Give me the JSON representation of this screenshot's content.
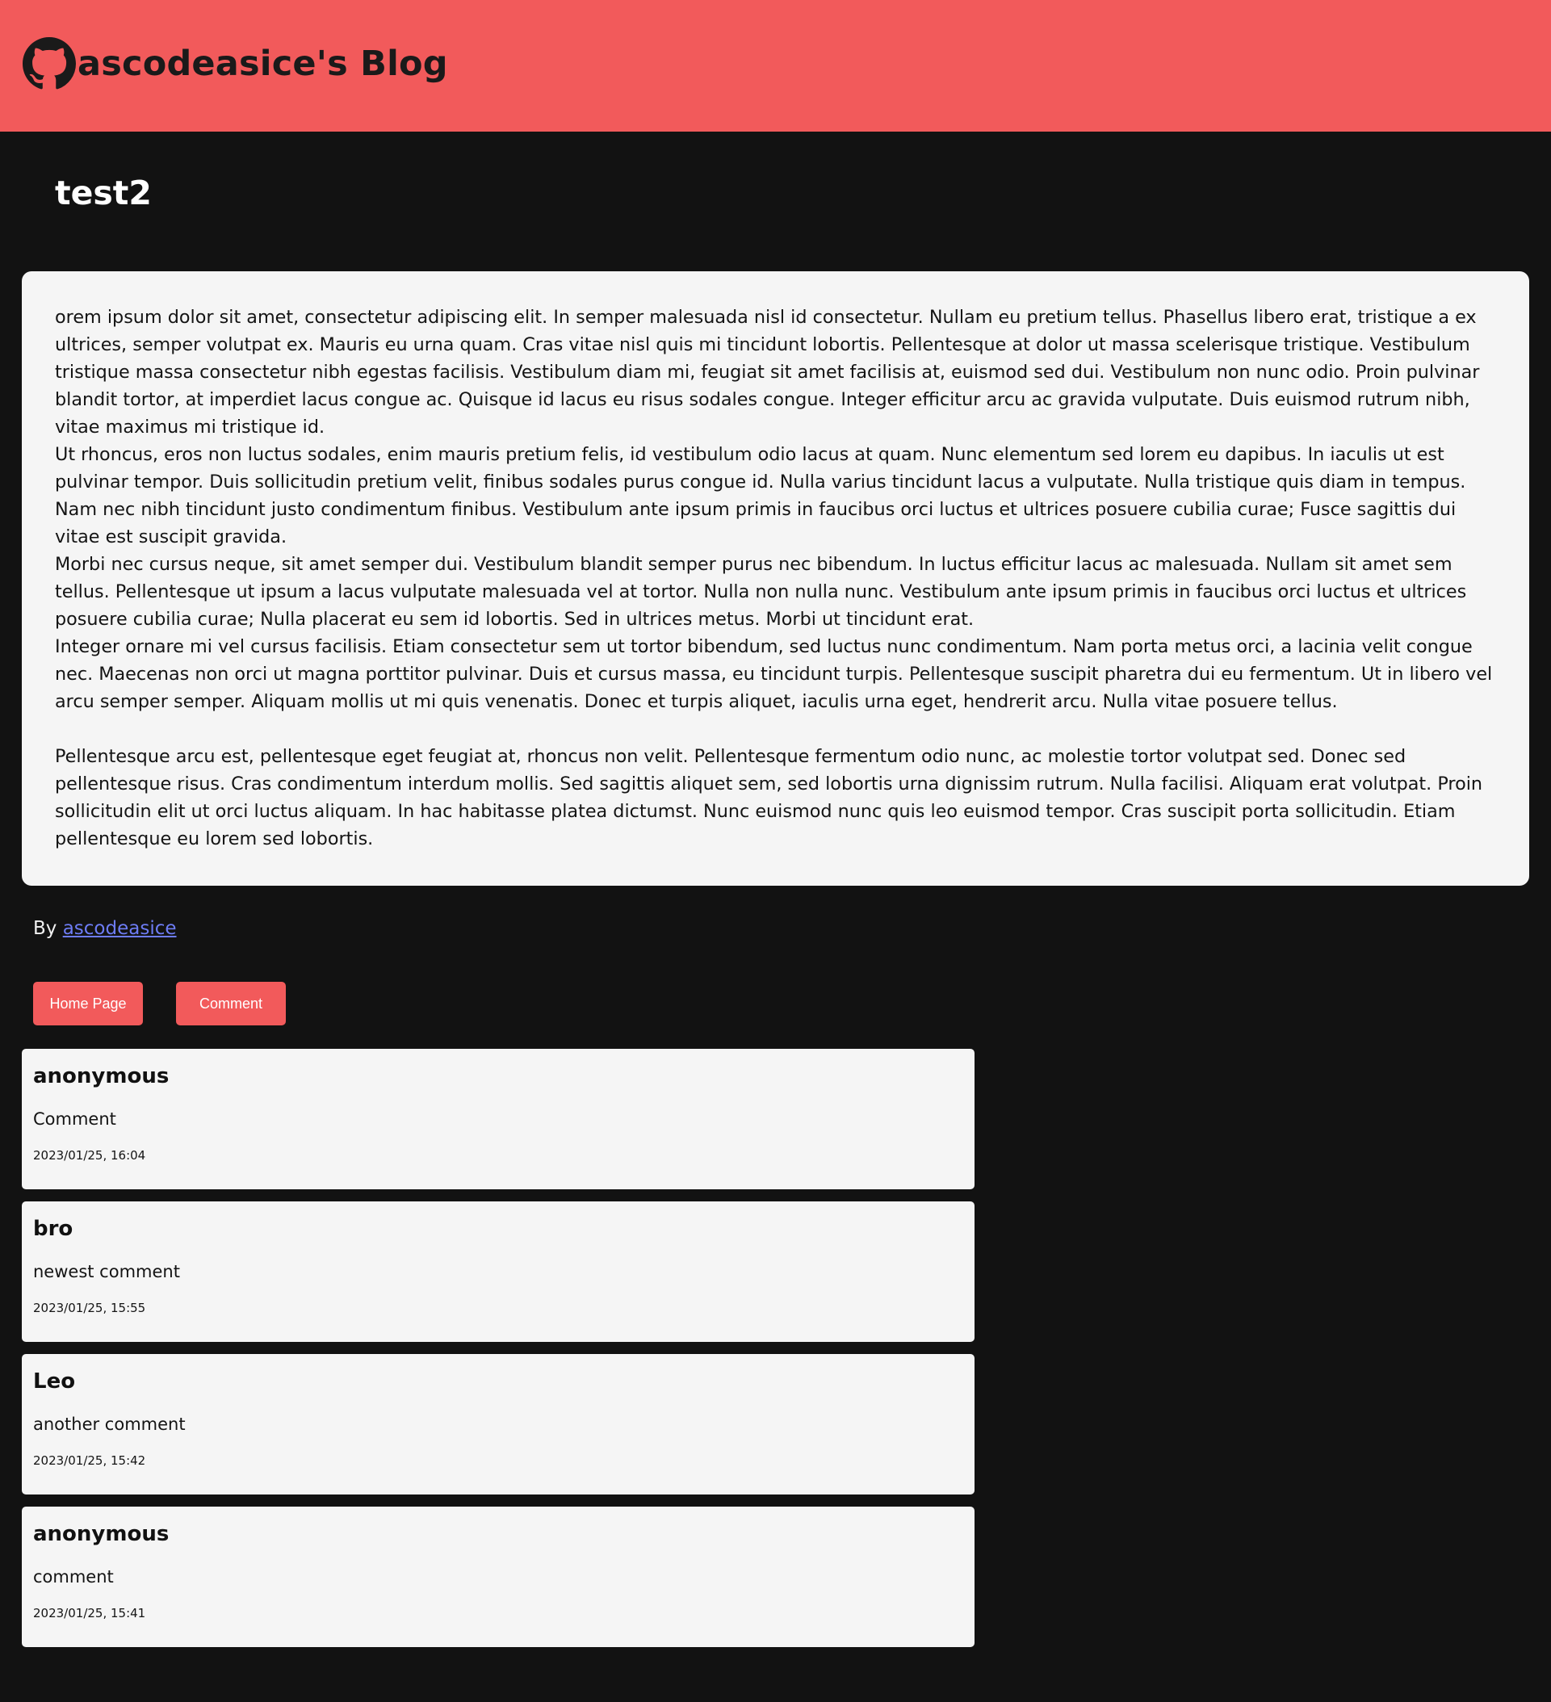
{
  "header": {
    "brand_icon": "github-icon",
    "brand_title": "ascodeasice's Blog",
    "background_color": "#f25a5b"
  },
  "post": {
    "title": "test2",
    "paragraphs": [
      "orem ipsum dolor sit amet, consectetur adipiscing elit. In semper malesuada nisl id consectetur. Nullam eu pretium tellus. Phasellus libero erat, tristique a ex ultrices, semper volutpat ex. Mauris eu urna quam. Cras vitae nisl quis mi tincidunt lobortis. Pellentesque at dolor ut massa scelerisque tristique. Vestibulum tristique massa consectetur nibh egestas facilisis. Vestibulum diam mi, feugiat sit amet facilisis at, euismod sed dui. Vestibulum non nunc odio. Proin pulvinar blandit tortor, at imperdiet lacus congue ac. Quisque id lacus eu risus sodales congue. Integer efficitur arcu ac gravida vulputate. Duis euismod rutrum nibh, vitae maximus mi tristique id.",
      "Ut rhoncus, eros non luctus sodales, enim mauris pretium felis, id vestibulum odio lacus at quam. Nunc elementum sed lorem eu dapibus. In iaculis ut est pulvinar tempor. Duis sollicitudin pretium velit, finibus sodales purus congue id. Nulla varius tincidunt lacus a vulputate. Nulla tristique quis diam in tempus. Nam nec nibh tincidunt justo condimentum finibus. Vestibulum ante ipsum primis in faucibus orci luctus et ultrices posuere cubilia curae; Fusce sagittis dui vitae est suscipit gravida.",
      "Morbi nec cursus neque, sit amet semper dui. Vestibulum blandit semper purus nec bibendum. In luctus efficitur lacus ac malesuada. Nullam sit amet sem tellus. Pellentesque ut ipsum a lacus vulputate malesuada vel at tortor. Nulla non nulla nunc. Vestibulum ante ipsum primis in faucibus orci luctus et ultrices posuere cubilia curae; Nulla placerat eu sem id lobortis. Sed in ultrices metus. Morbi ut tincidunt erat.",
      "Integer ornare mi vel cursus facilisis. Etiam consectetur sem ut tortor bibendum, sed luctus nunc condimentum. Nam porta metus orci, a lacinia velit congue nec. Maecenas non orci ut magna porttitor pulvinar. Duis et cursus massa, eu tincidunt turpis. Pellentesque suscipit pharetra dui eu fermentum. Ut in libero vel arcu semper semper. Aliquam mollis ut mi quis venenatis. Donec et turpis aliquet, iaculis urna eget, hendrerit arcu. Nulla vitae posuere tellus.",
      "Pellentesque arcu est, pellentesque eget feugiat at, rhoncus non velit. Pellentesque fermentum odio nunc, ac molestie tortor volutpat sed. Donec sed pellentesque risus. Cras condimentum interdum mollis. Sed sagittis aliquet sem, sed lobortis urna dignissim rutrum. Nulla facilisi. Aliquam erat volutpat. Proin sollicitudin elit ut orci luctus aliquam. In hac habitasse platea dictumst. Nunc euismod nunc quis leo euismod tempor. Cras suscipit porta sollicitudin. Etiam pellentesque eu lorem sed lobortis."
    ],
    "byline_prefix": "By",
    "author_link": "ascodeasice"
  },
  "actions": {
    "home_label": "Home Page",
    "comment_label": "Comment"
  },
  "comments": [
    {
      "author": "anonymous",
      "text": "Comment",
      "time": "2023/01/25, 16:04"
    },
    {
      "author": "bro",
      "text": "newest comment",
      "time": "2023/01/25, 15:55"
    },
    {
      "author": "Leo",
      "text": "another comment",
      "time": "2023/01/25, 15:42"
    },
    {
      "author": "anonymous",
      "text": "comment",
      "time": "2023/01/25, 15:41"
    }
  ],
  "colors": {
    "accent": "#f25a5b",
    "page_background": "#121212",
    "card_background": "#f5f5f5",
    "link": "#6d7cf4"
  }
}
